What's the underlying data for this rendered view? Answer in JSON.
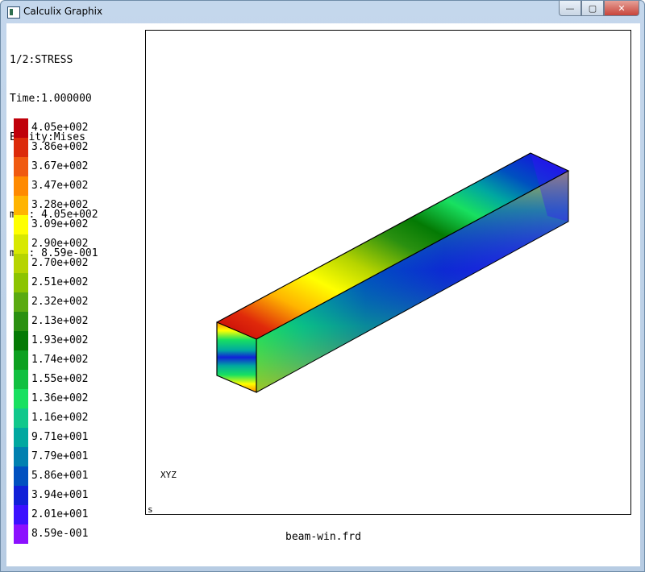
{
  "window": {
    "title": "Calculix Graphix",
    "controls": {
      "minimize": "—",
      "maximize": "▢",
      "close": "✕"
    }
  },
  "header": {
    "dataset": "1/2:STRESS",
    "time": "Time:1.000000",
    "entity": "Entity:Mises",
    "max": "max: 4.05e+002",
    "min": "min: 8.59e-001"
  },
  "legend": [
    {
      "value": "4.05e+002",
      "color": "#c0000a"
    },
    {
      "value": "3.86e+002",
      "color": "#dc2a0a"
    },
    {
      "value": "3.67e+002",
      "color": "#f05a10"
    },
    {
      "value": "3.47e+002",
      "color": "#ff8a00"
    },
    {
      "value": "3.28e+002",
      "color": "#ffb400"
    },
    {
      "value": "3.09e+002",
      "color": "#ffff00"
    },
    {
      "value": "2.90e+002",
      "color": "#d8e800"
    },
    {
      "value": "2.70e+002",
      "color": "#b6d400"
    },
    {
      "value": "2.51e+002",
      "color": "#8cc400"
    },
    {
      "value": "2.32e+002",
      "color": "#5aaa10"
    },
    {
      "value": "2.13e+002",
      "color": "#2a9010"
    },
    {
      "value": "1.93e+002",
      "color": "#047a04"
    },
    {
      "value": "1.74e+002",
      "color": "#0ca020"
    },
    {
      "value": "1.55e+002",
      "color": "#10c040"
    },
    {
      "value": "1.36e+002",
      "color": "#18e060"
    },
    {
      "value": "1.16e+002",
      "color": "#10c88c"
    },
    {
      "value": "9.71e+001",
      "color": "#00a8a0"
    },
    {
      "value": "7.79e+001",
      "color": "#0080b0"
    },
    {
      "value": "5.86e+001",
      "color": "#0050c0"
    },
    {
      "value": "3.94e+001",
      "color": "#1020d8"
    },
    {
      "value": "2.01e+001",
      "color": "#3c10ff"
    },
    {
      "value": "8.59e-001",
      "color": "#8c10ff"
    }
  ],
  "viewport": {
    "axis_label": "XYZ",
    "corner_mark": "s"
  },
  "footer": {
    "filename": "beam-win.frd"
  }
}
